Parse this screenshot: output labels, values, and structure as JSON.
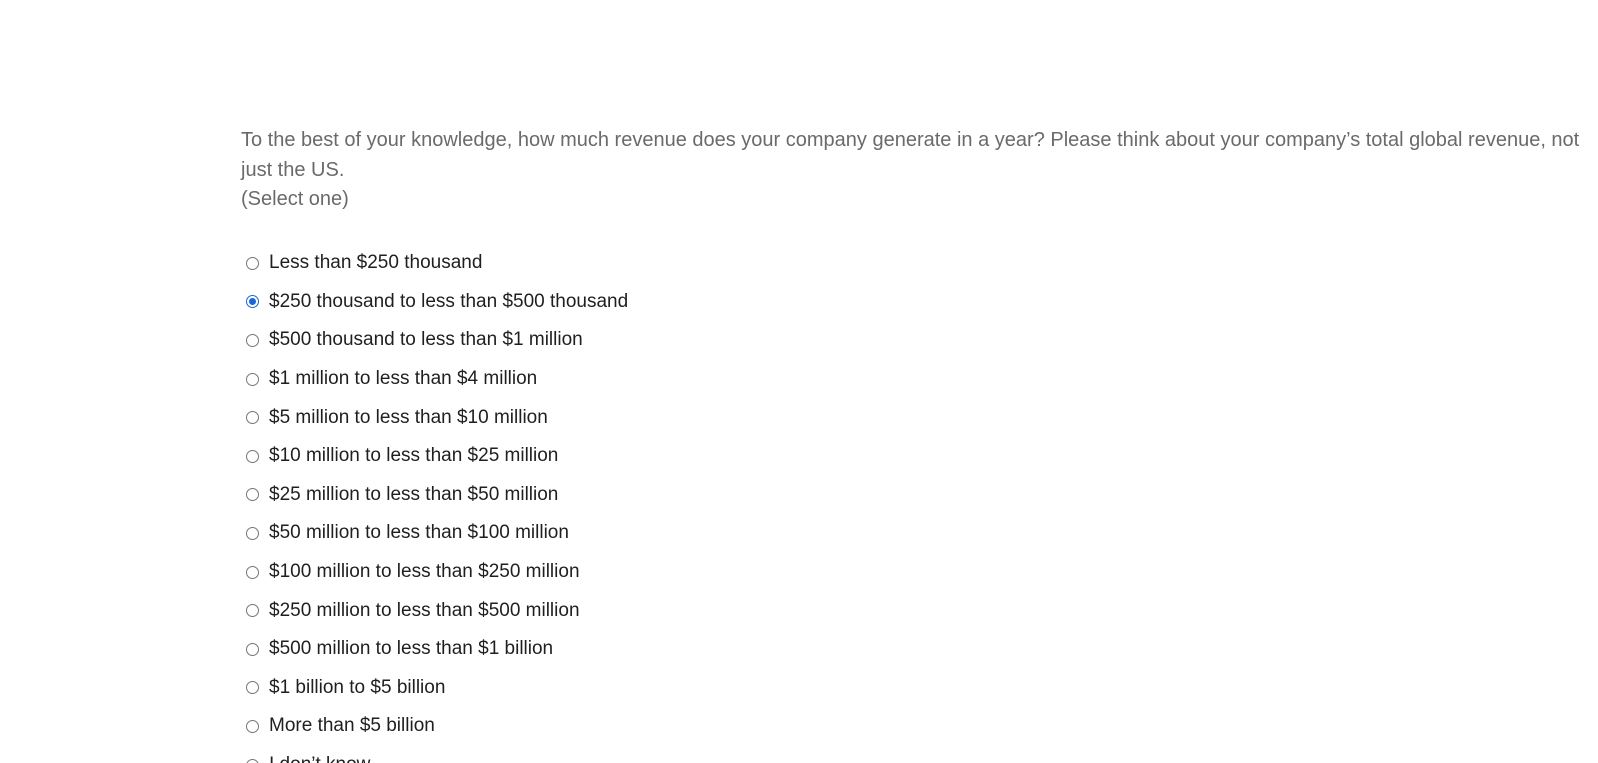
{
  "question": {
    "text": "To the best of your knowledge, how much revenue does your company generate in a year? Please think about your company’s total global revenue, not just the US.",
    "instruction": "(Select one)"
  },
  "options": [
    {
      "label": "Less than $250 thousand",
      "checked": false
    },
    {
      "label": "$250 thousand to less than $500 thousand",
      "checked": true
    },
    {
      "label": "$500 thousand to less than $1 million",
      "checked": false
    },
    {
      "label": "$1 million to less than $4 million",
      "checked": false
    },
    {
      "label": "$5 million to less than $10 million",
      "checked": false
    },
    {
      "label": "$10 million to less than $25 million",
      "checked": false
    },
    {
      "label": "$25 million to less than $50 million",
      "checked": false
    },
    {
      "label": "$50 million to less than $100 million",
      "checked": false
    },
    {
      "label": "$100 million to less than $250 million",
      "checked": false
    },
    {
      "label": "$250 million to less than $500 million",
      "checked": false
    },
    {
      "label": "$500 million to less than $1 billion",
      "checked": false
    },
    {
      "label": "$1 billion to $5 billion",
      "checked": false
    },
    {
      "label": "More than $5 billion",
      "checked": false
    },
    {
      "label": "I don’t know",
      "checked": false
    }
  ],
  "colors": {
    "accent": "#1a66d6",
    "question_text": "#6a6a6a",
    "option_text": "#1f1f1f"
  }
}
